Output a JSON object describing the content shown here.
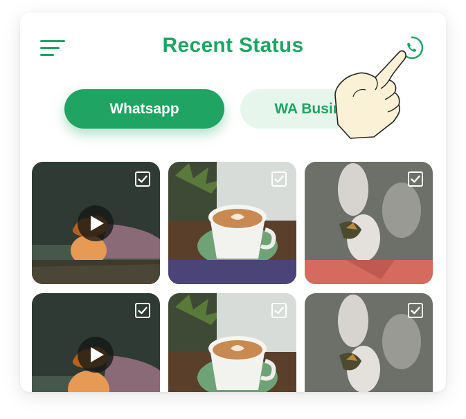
{
  "header": {
    "title": "Recent Status",
    "menu_icon": "hamburger-menu-icon",
    "action_icon": "whatsapp-icon"
  },
  "tabs": [
    {
      "label": "Whatsapp",
      "active": true
    },
    {
      "label": "WA Business",
      "active": false
    }
  ],
  "grid": {
    "items": [
      {
        "kind": "video",
        "scene": "orange-vase",
        "checked": true
      },
      {
        "kind": "image",
        "scene": "coffee-cup",
        "checked": true
      },
      {
        "kind": "image",
        "scene": "white-flower",
        "checked": true
      },
      {
        "kind": "video",
        "scene": "orange-vase",
        "checked": true
      },
      {
        "kind": "image",
        "scene": "coffee-cup",
        "checked": true
      },
      {
        "kind": "image",
        "scene": "white-flower",
        "checked": true
      }
    ]
  },
  "colors": {
    "accent": "#1fa463",
    "tab_inactive_bg": "#e6f6ec",
    "card_bg": "#ffffff"
  },
  "overlay": {
    "pointer_icon": "pointing-hand-icon"
  }
}
